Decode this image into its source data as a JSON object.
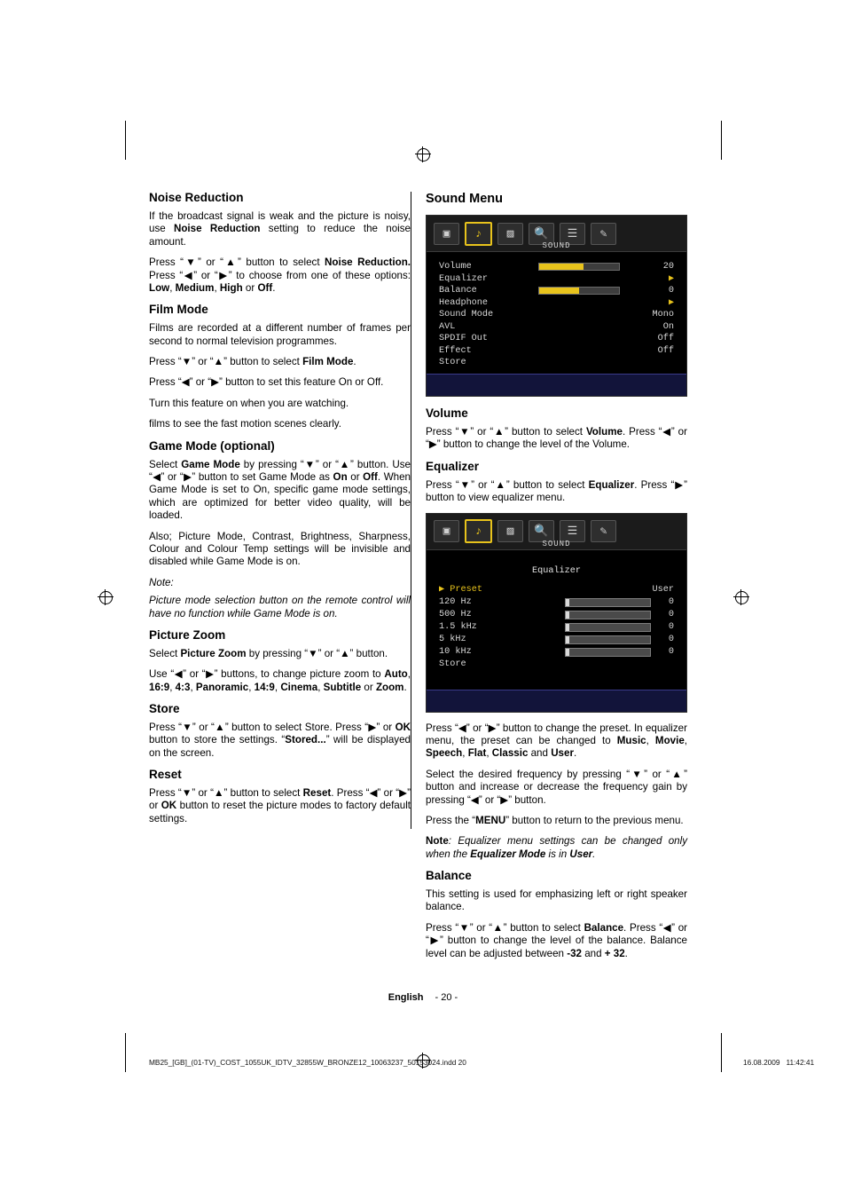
{
  "left_column": {
    "sections": [
      {
        "heading": "Noise Reduction",
        "paragraphs": [
          "If the broadcast signal is weak and the picture is noisy, use <b>Noise Reduction</b> setting to reduce the noise amount.",
          "Press “▼” or “▲” button to select <b>Noise Reduction.</b> Press “◀” or “▶” to choose from one of these options: <b>Low</b>, <b>Medium</b>, <b>High</b> or <b>Off</b>."
        ]
      },
      {
        "heading": "Film Mode",
        "paragraphs": [
          "Films are recorded at a different number of frames per second to normal television programmes.",
          "Press “▼” or “▲” button to select <b>Film Mode</b>.",
          "Press “◀” or “▶” button to set this feature On or Off.",
          "Turn this feature on when you are watching.",
          "films to see the fast motion scenes clearly."
        ]
      },
      {
        "heading": "Game Mode (optional)",
        "paragraphs": [
          "Select <b>Game Mode</b> by pressing “▼” or “▲” button. Use “◀” or “▶” button to set Game Mode as <b>On</b> or <b>Off</b>. When Game Mode is set to On, specific game mode settings, which are optimized for better video quality, will be loaded.",
          "Also; Picture Mode, Contrast, Brightness, Sharpness, Colour and Colour Temp settings will be invisible and disabled while Game Mode is on."
        ],
        "note_label": "Note:",
        "note_text": "Picture mode selection button on the remote control will have no function while Game Mode is on."
      },
      {
        "heading": "Picture Zoom",
        "paragraphs": [
          "Select <b>Picture Zoom</b> by pressing “▼” or “▲” button.",
          "Use “◀” or “▶” buttons, to change picture zoom  to <b>Auto</b>, <b>16:9</b>, <b>4:3</b>, <b>Panoramic</b>, <b>14:9</b>, <b>Cinema</b>, <b>Subtitle</b> or <b>Zoom</b>."
        ]
      },
      {
        "heading": "Store",
        "paragraphs": [
          "Press “▼” or “▲” button to select Store. Press “▶” or <b>OK</b> button to store the settings. “<b>Stored...</b>” will be displayed on the screen."
        ]
      },
      {
        "heading": "Reset",
        "paragraphs": [
          "Press “▼” or “▲” button to select <b>Reset</b>. Press “◀” or “▶” or <b>OK</b> button to reset the picture modes to factory default settings."
        ]
      }
    ]
  },
  "right_column": {
    "title": "Sound Menu",
    "sound_osd": {
      "menu_title": "SOUND",
      "icons": [
        "picture-icon",
        "sound-icon",
        "feature-icon",
        "install-icon",
        "source-icon",
        "pc-icon"
      ],
      "selected_icon_index": 1,
      "rows": [
        {
          "label": "Volume",
          "type": "bar",
          "fill": 55,
          "value": "20"
        },
        {
          "label": "Equalizer",
          "type": "arrow",
          "value": "▶"
        },
        {
          "label": "Balance",
          "type": "bar",
          "fill": 50,
          "value": "0"
        },
        {
          "label": "Headphone",
          "type": "arrow",
          "value": "▶"
        },
        {
          "label": "Sound Mode",
          "type": "text",
          "value": "Mono"
        },
        {
          "label": "AVL",
          "type": "text",
          "value": "On"
        },
        {
          "label": "SPDIF Out",
          "type": "text",
          "value": "Off"
        },
        {
          "label": "Effect",
          "type": "text",
          "value": "Off"
        },
        {
          "label": "Store",
          "type": "text",
          "value": ""
        }
      ]
    },
    "sections": [
      {
        "heading": "Volume",
        "paragraphs": [
          "Press “▼” or “▲” button to select <b>Volume</b>. Press “◀” or “▶” button to change the level of the Volume."
        ]
      },
      {
        "heading": "Equalizer",
        "paragraphs": [
          "Press “▼” or “▲” button to select <b>Equalizer</b>. Press “▶” button to view equalizer menu."
        ]
      }
    ],
    "equalizer_osd": {
      "menu_title": "SOUND",
      "caption": "Equalizer",
      "selected_icon_index": 1,
      "header": {
        "label": "Preset",
        "value": "User"
      },
      "bands": [
        {
          "label": "120 Hz",
          "value": "0"
        },
        {
          "label": "500 Hz",
          "value": "0"
        },
        {
          "label": "1.5 kHz",
          "value": "0"
        },
        {
          "label": "5 kHz",
          "value": "0"
        },
        {
          "label": "10 kHz",
          "value": "0"
        }
      ],
      "store_label": "Store"
    },
    "sections_after": [
      {
        "paragraphs": [
          "Press “◀” or “▶” button to change the preset. In equalizer menu, the preset can be changed to <b>Music</b>, <b>Movie</b>, <b>Speech</b>, <b>Flat</b>, <b>Classic</b> and <b>User</b>.",
          "Select the desired frequency by pressing “▼” or “▲” button and increase or decrease the frequency gain by pressing “◀” or “▶” button.",
          "Press the “<b>MENU</b>” button to return to the previous menu."
        ],
        "note": "<b>Note</b><i>: Equalizer menu settings can be changed only when the </i><b><i>Equalizer Mode</i></b><i> is in </i><b><i>User</i></b><i>.</i>"
      },
      {
        "heading": "Balance",
        "paragraphs": [
          "This setting is used for emphasizing left or right speaker balance.",
          "Press “▼” or “▲” button to select <b>Balance</b>. Press “◀” or “▶” button to change the level of the balance. Balance level can be adjusted between <b>-32</b> and <b>+ 32</b>."
        ]
      }
    ]
  },
  "footer": {
    "language": "English",
    "page": "- 20 -"
  },
  "print_info": {
    "filename": "MB25_[GB]_(01-TV)_COST_1055UK_IDTV_32855W_BRONZE12_10063237_50153024.indd   20",
    "datetime": "16.08.2009   11:42:41"
  }
}
